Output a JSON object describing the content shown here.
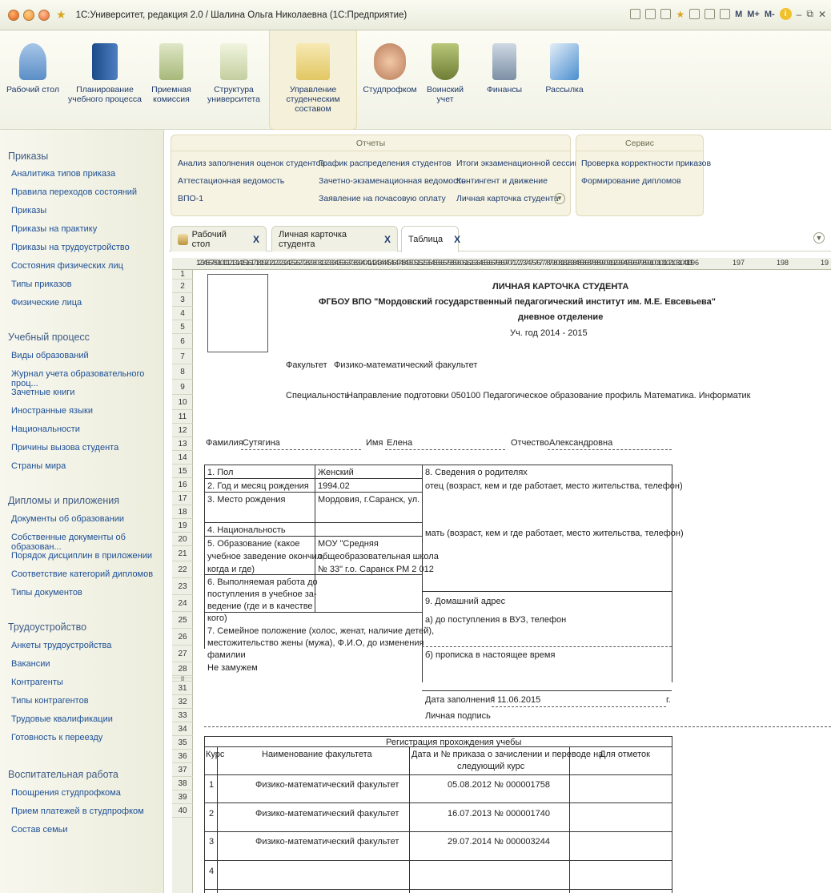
{
  "titlebar": {
    "title": "1С:Университет, редакция 2.0 / Шалина Ольга Николаевна  (1С:Предприятие)",
    "m_buttons": [
      "M",
      "M+",
      "M-"
    ]
  },
  "sections": [
    {
      "label": "Рабочий стол",
      "icon": "desk-icon"
    },
    {
      "label": "Планирование учебного процесса",
      "icon": "book-icon"
    },
    {
      "label": "Приемная комиссия",
      "icon": "clipboard-icon"
    },
    {
      "label": "Структура университета",
      "icon": "structure-icon"
    },
    {
      "label": "Управление студенческим составом",
      "icon": "id-card-icon"
    },
    {
      "label": "Студпрофком",
      "icon": "people-icon"
    },
    {
      "label": "Воинский учет",
      "icon": "shield-icon"
    },
    {
      "label": "Финансы",
      "icon": "calculator-icon"
    },
    {
      "label": "Рассылка",
      "icon": "mail-icon"
    }
  ],
  "left_panel": {
    "groups": [
      {
        "title": "Приказы",
        "items": [
          "Аналитика типов приказа",
          "Правила переходов состояний",
          "Приказы",
          "Приказы на практику",
          "Приказы на трудоустройство",
          "Состояния физических лиц",
          "Типы приказов",
          "Физические лица"
        ]
      },
      {
        "title": "Учебный процесс",
        "items": [
          "Виды образований",
          "Журнал учета образовательного проц...",
          "Зачетные книги",
          "Иностранные языки",
          "Национальности",
          "Причины вызова студента",
          "Страны мира"
        ]
      },
      {
        "title": "Дипломы и приложения",
        "items": [
          "Документы об образовании",
          "Собственные документы об образован...",
          "Порядок дисциплин в приложении",
          "Соответствие категорий дипломов",
          "Типы документов"
        ]
      },
      {
        "title": "Трудоустройство",
        "items": [
          "Анкеты трудоустройства",
          "Вакансии",
          "Контрагенты",
          "Типы контрагентов",
          "Трудовые квалификации",
          "Готовность к переезду"
        ]
      },
      {
        "title": "Воспитательная работа",
        "items": [
          "Поощрения студпрофкома",
          "Прием платежей в студпрофком",
          "Состав семьи"
        ]
      }
    ]
  },
  "reports_panel": {
    "title": "Отчеты",
    "col1": [
      "Анализ заполнения оценок студентов",
      "Аттестационная ведомость",
      "ВПО-1"
    ],
    "col2": [
      "График распределения студентов",
      "Зачетно-экзаменационная ведомость",
      "Заявление на почасовую оплату"
    ],
    "col3": [
      "Итоги экзаменационной сессии",
      "Контингент и движение",
      "Личная карточка студента"
    ]
  },
  "service_panel": {
    "title": "Сервис",
    "items": [
      "Проверка корректности приказов",
      "Формирование дипломов"
    ]
  },
  "tabs": [
    {
      "label": "Рабочий стол",
      "close": "X"
    },
    {
      "label": "Личная карточка студента",
      "close": "X"
    },
    {
      "label": "Таблица",
      "close": "X"
    }
  ],
  "sheet": {
    "col_header_packed": "12345678910111213141516171819202122232425262728293031323334353637383940414243444546474849505152535455565758596061626364656667686970717273747576777879808182838485868788899091929394959697989910010110210310410510610710810911011111211311411511611711811912012112212312412512612712812913013113213313413513613713813914014114214314414514614714814915015115215315415515615715815916016116216316416516616716816917017117217317417517617717817918018118218318418518618718818919019119219319419 5",
    "col_numbers": [
      "196",
      "197",
      "198",
      "19"
    ],
    "rows": [
      "1",
      "2",
      "3",
      "4",
      "5",
      "6",
      "7",
      "8",
      "9",
      "10",
      "11",
      "12",
      "13",
      "14",
      "15",
      "16",
      "17",
      "18",
      "19",
      "20",
      "21",
      "22",
      "23",
      "24",
      "25",
      "26",
      "27",
      "28",
      "29",
      "30",
      "31",
      "32",
      "33",
      "34",
      "35",
      "36",
      "37",
      "38",
      "39",
      "40"
    ]
  },
  "card": {
    "title": "ЛИЧНАЯ КАРТОЧКА СТУДЕНТА",
    "institution": "ФГБОУ ВПО \"Мордовский государственный педагогический институт им. М.Е. Евсевьева\"",
    "department": "дневное отделение",
    "year": "Уч. год  2014 - 2015",
    "faculty_label": "Факультет",
    "faculty": "Физико-математический факультет",
    "speciality_label": "Специальность",
    "speciality": "Направление подготовки 050100 Педагогическое образование профиль Математика. Информатик",
    "surname_label": "Фамилия",
    "surname": "Сутягина",
    "name_label": "Имя",
    "name": "Елена",
    "patronymic_label": "Отчество",
    "patronymic": "Александровна",
    "f1": "1. Пол",
    "v1": "Женский",
    "f2": "2. Год и месяц рождения",
    "v2": "1994.02",
    "f3": "3. Место рождения",
    "v3": "Мордовия, г.Саранск, ул.   Р. Л",
    "f4": "4. Национальность",
    "f5a": "5. Образование (какое",
    "f5b": "учебное заведение окончил,",
    "f5c": "когда и где)",
    "v5a": "МОУ \"Средняя",
    "v5b": "общеобразовательная школа",
    "v5c": "№ 33\" г.о. Саранск РМ  2 012",
    "f6a": "6. Выполняемая работа до",
    "f6b": "поступления в учебное за-",
    "f6c": "ведение (где и в качестве",
    "f6d": "кого)",
    "f7a": "7. Семейное положение (холос, женат, наличие детей),",
    "f7b": "местожительство жены (мужа), Ф.И.О, до изменения",
    "f7c": "фамилии",
    "v7": "Не замужем",
    "parents": "8. Сведения о родителях",
    "father": "отец (возраст, кем и где работает, место жительства, телефон)",
    "mother": "мать (возраст, кем и где работает, место жительства, телефон)",
    "address": "9. Домашний адрес",
    "address_a": "а) до поступления в ВУЗ, телефон",
    "address_b": "б) прописка в настоящее время",
    "fill_date_label": "Дата заполнения",
    "fill_date": "\" 11.06.2015",
    "fill_date_suffix": "г.",
    "signature": "Личная подпись"
  },
  "registration": {
    "title": "Регистрация прохождения учебы",
    "headers": [
      "Курс",
      "Наименование факультета",
      "Дата и № приказа о зачислении и переводе на",
      "следующий курс",
      "Для отметок"
    ],
    "rows": [
      {
        "course": "1",
        "faculty": "Физико-математический факультет",
        "order": "05.08.2012 № 000001758"
      },
      {
        "course": "2",
        "faculty": "Физико-математический факультет",
        "order": "16.07.2013 № 000001740"
      },
      {
        "course": "3",
        "faculty": "Физико-математический факультет",
        "order": "29.07.2014 № 000003244"
      },
      {
        "course": "4",
        "faculty": "",
        "order": ""
      }
    ]
  }
}
